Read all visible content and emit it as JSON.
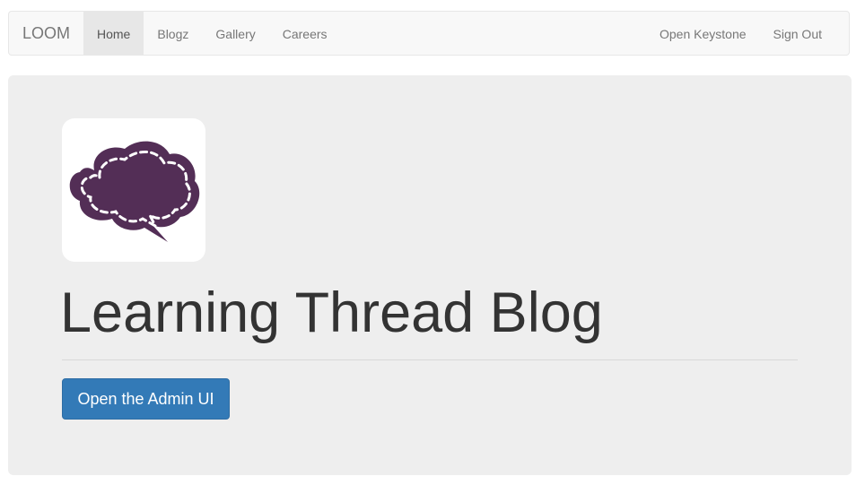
{
  "navbar": {
    "brand": "LOOM",
    "left_items": [
      {
        "label": "Home",
        "active": true
      },
      {
        "label": "Blogz",
        "active": false
      },
      {
        "label": "Gallery",
        "active": false
      },
      {
        "label": "Careers",
        "active": false
      }
    ],
    "right_items": [
      {
        "label": "Open Keystone"
      },
      {
        "label": "Sign Out"
      }
    ]
  },
  "hero": {
    "logo_icon": "speech-bubble-brain-icon",
    "title": "Learning Thread Blog",
    "button_label": "Open the Admin UI"
  },
  "colors": {
    "logo_fill": "#532e56",
    "primary": "#337ab7",
    "jumbotron_bg": "#eeeeee",
    "navbar_bg": "#f8f8f8"
  }
}
